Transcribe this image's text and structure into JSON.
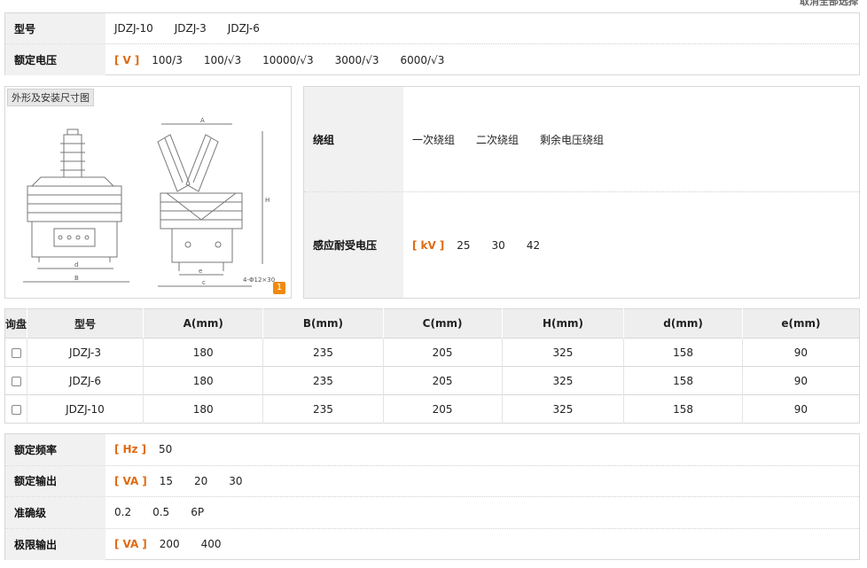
{
  "header": {
    "clear_all_label": "取消全部选择"
  },
  "model_panel": {
    "rows": [
      {
        "label": "型号",
        "values": [
          "JDZJ-10",
          "JDZJ-3",
          "JDZJ-6"
        ]
      },
      {
        "label": "额定电压",
        "unit": "V",
        "values": [
          "100/3",
          "100/√3",
          "10000/√3",
          "3000/√3",
          "6000/√3"
        ]
      }
    ]
  },
  "diagram": {
    "title": "外形及安装尺寸图",
    "zoom_label": "1"
  },
  "winding_panel": {
    "rows": [
      {
        "label": "绕组",
        "values": [
          "一次绕组",
          "二次绕组",
          "剩余电压绕组"
        ]
      },
      {
        "label": "感应耐受电压",
        "unit": "kV",
        "values": [
          "25",
          "30",
          "42"
        ]
      }
    ]
  },
  "table": {
    "headers": [
      "询盘",
      "型号",
      "A(mm)",
      "B(mm)",
      "C(mm)",
      "H(mm)",
      "d(mm)",
      "e(mm)"
    ],
    "rows": [
      [
        "JDZJ-3",
        "180",
        "235",
        "205",
        "325",
        "158",
        "90"
      ],
      [
        "JDZJ-6",
        "180",
        "235",
        "205",
        "325",
        "158",
        "90"
      ],
      [
        "JDZJ-10",
        "180",
        "235",
        "205",
        "325",
        "158",
        "90"
      ]
    ]
  },
  "spec_panel": {
    "rows": [
      {
        "label": "额定频率",
        "unit": "Hz",
        "values": [
          "50"
        ]
      },
      {
        "label": "额定输出",
        "unit": "VA",
        "values": [
          "15",
          "20",
          "30"
        ]
      },
      {
        "label": "准确级",
        "values": [
          "0.2",
          "0.5",
          "6P"
        ]
      },
      {
        "label": "极限输出",
        "unit": "VA",
        "values": [
          "200",
          "400"
        ]
      }
    ]
  },
  "colors": {
    "accent": "#e06a10",
    "label_bg": "#f1f1f1",
    "border": "#d8d8d8"
  }
}
